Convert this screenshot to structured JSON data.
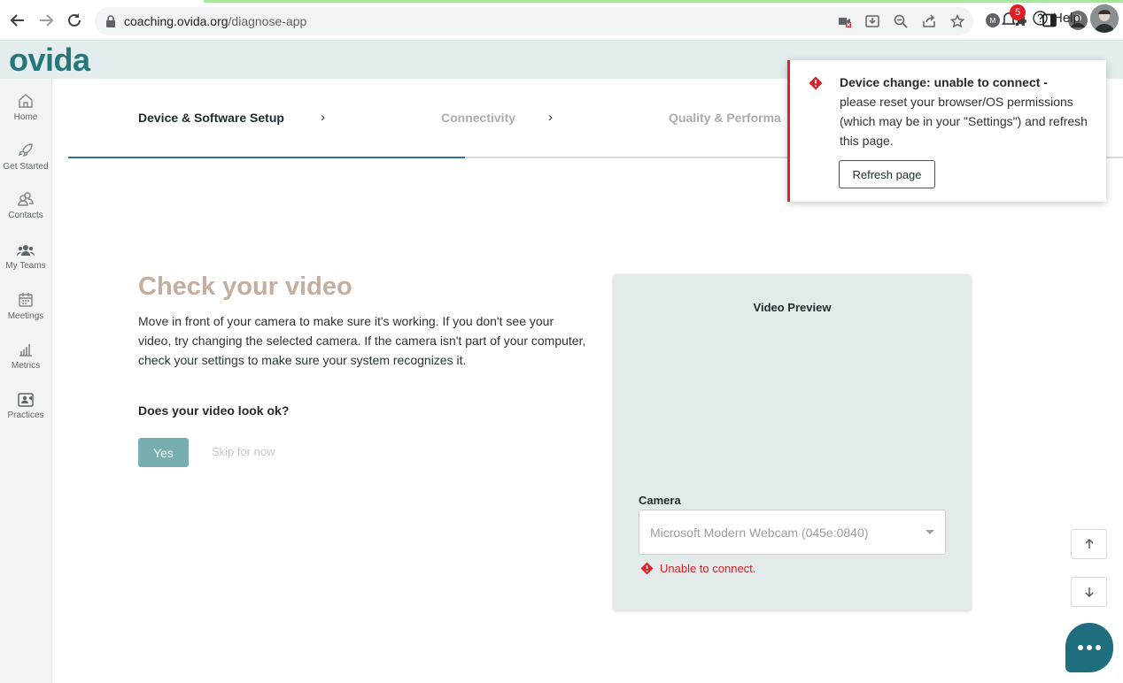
{
  "browser": {
    "url_host": "coaching.ovida.org",
    "url_path": "/diagnose-app",
    "icons": [
      "back-icon",
      "forward-icon",
      "reload-icon",
      "lock-icon",
      "camera-blocked-icon",
      "install-icon",
      "zoom-icon",
      "share-icon",
      "bookmark-star-icon",
      "extension-icon",
      "puzzle-icon",
      "sidepanel-icon",
      "profile-avatar",
      "menu-kebab-icon"
    ]
  },
  "header": {
    "logo": "ovida",
    "notification_count": "5",
    "help_label": "Help"
  },
  "sidebar": {
    "items": [
      {
        "label": "Home",
        "icon": "home-icon"
      },
      {
        "label": "Get Started",
        "icon": "rocket-icon"
      },
      {
        "label": "Contacts",
        "icon": "contacts-icon"
      },
      {
        "label": "My Teams",
        "icon": "teams-icon"
      },
      {
        "label": "Meetings",
        "icon": "calendar-icon"
      },
      {
        "label": "Metrics",
        "icon": "bar-chart-icon"
      },
      {
        "label": "Practices",
        "icon": "video-practice-icon"
      }
    ]
  },
  "steps": [
    {
      "label": "Device & Software Setup",
      "state": "active"
    },
    {
      "label": "Connectivity",
      "state": "inactive"
    },
    {
      "label": "Quality & Performa",
      "state": "inactive"
    }
  ],
  "main": {
    "title": "Check your video",
    "description": "Move in front of your camera to make sure it's working. If you don't see your video, try changing the selected camera. If the camera isn't part of your computer, check your settings to make sure your system recognizes it.",
    "question": "Does your video look ok?",
    "yes_label": "Yes",
    "skip_label": "Skip for now"
  },
  "preview": {
    "title": "Video Preview",
    "camera_label": "Camera",
    "camera_value": "Microsoft Modern Webcam (045e:0840)",
    "error_text": "Unable to connect."
  },
  "toast": {
    "heading": "Device change: unable to connect -",
    "body": "please reset your browser/OS permissions (which may be in your \"Settings\") and refresh this page.",
    "button_label": "Refresh page"
  },
  "colors": {
    "brand_teal": "#25777a",
    "error_red": "#e31b23",
    "title_tan": "#c4aea0",
    "progress_blue": "#2f6f9a"
  }
}
